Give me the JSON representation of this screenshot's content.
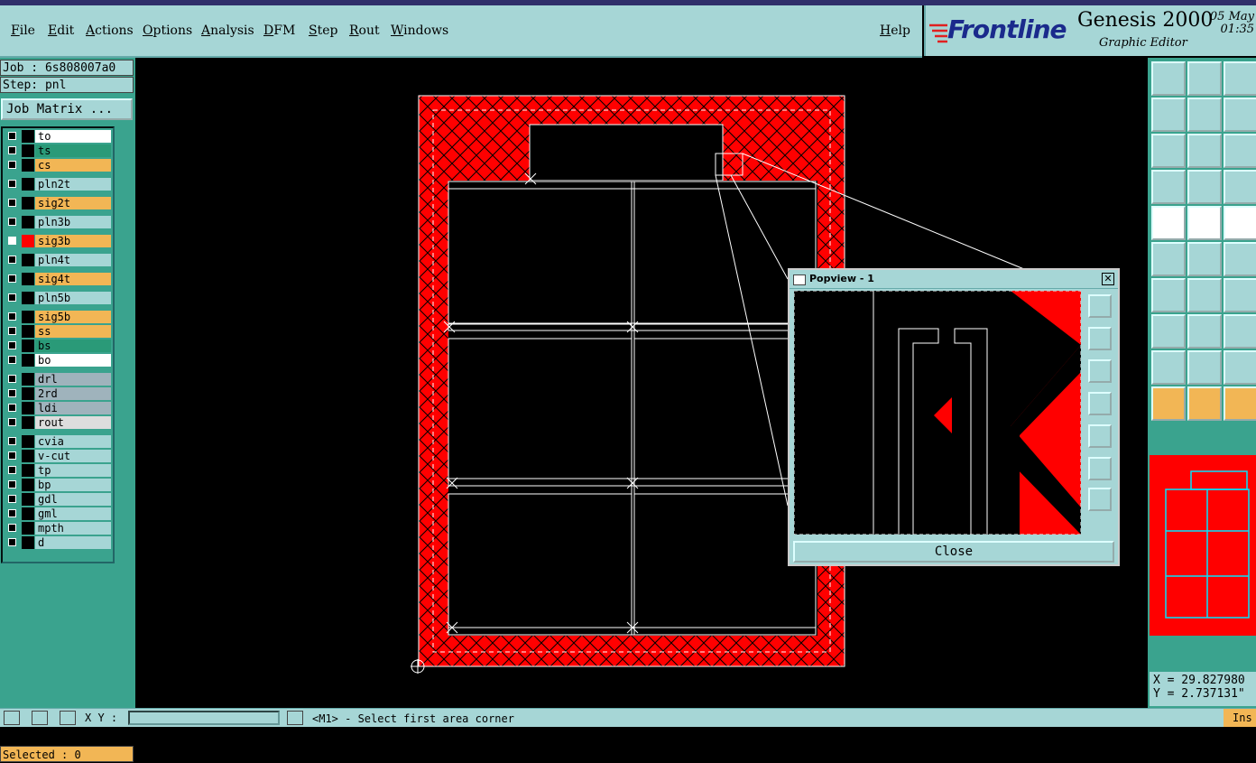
{
  "menubar": {
    "items": [
      "File",
      "Edit",
      "Actions",
      "Options",
      "Analysis",
      "DFM",
      "Step",
      "Rout",
      "Windows"
    ],
    "help": "Help"
  },
  "brand": {
    "logo": "Frontline",
    "app": "Genesis 2000",
    "subtitle": "Graphic Editor",
    "date": "05 May",
    "time": "01:35"
  },
  "job": {
    "job": "Job : 6s808007a0",
    "step": "Step: pnl",
    "matrix_button": "Job Matrix ..."
  },
  "layers": [
    {
      "name": "to",
      "color": "#ffffff"
    },
    {
      "name": "ts",
      "color": "#2a9a78"
    },
    {
      "name": "cs",
      "color": "#f2b655"
    },
    {
      "name": "pln2t",
      "color": "#a6d6d6"
    },
    {
      "name": "sig2t",
      "color": "#f2b655"
    },
    {
      "name": "pln3b",
      "color": "#a6d6d6"
    },
    {
      "name": "sig3b",
      "color": "#f2b655"
    },
    {
      "name": "pln4t",
      "color": "#a6d6d6"
    },
    {
      "name": "sig4t",
      "color": "#f2b655"
    },
    {
      "name": "pln5b",
      "color": "#a6d6d6"
    },
    {
      "name": "sig5b",
      "color": "#f2b655"
    },
    {
      "name": "ss",
      "color": "#f2b655"
    },
    {
      "name": "bs",
      "color": "#2a9a78"
    },
    {
      "name": "bo",
      "color": "#ffffff"
    },
    {
      "name": "drl",
      "color": "#9fb3bc"
    },
    {
      "name": "2rd",
      "color": "#9fb3bc"
    },
    {
      "name": "ldi",
      "color": "#9fb3bc"
    },
    {
      "name": "rout",
      "color": "#dddddd"
    },
    {
      "name": "cvia",
      "color": "#a6d6d6"
    },
    {
      "name": "v-cut",
      "color": "#a6d6d6"
    },
    {
      "name": "tp",
      "color": "#a6d6d6"
    },
    {
      "name": "bp",
      "color": "#a6d6d6"
    },
    {
      "name": "gdl",
      "color": "#a6d6d6"
    },
    {
      "name": "gml",
      "color": "#a6d6d6"
    },
    {
      "name": "mpth",
      "color": "#a6d6d6"
    },
    {
      "name": "d",
      "color": "#a6d6d6"
    }
  ],
  "active_layer": "sig3b",
  "selected": "Selected : 0",
  "popview": {
    "title": "Popview - 1",
    "close": "Close"
  },
  "coords": {
    "x": "X = 29.827980",
    "y": "Y = 2.737131\""
  },
  "status": {
    "xy_label": "X Y :",
    "message": "<M1> - Select first area corner",
    "mode": "Ins"
  },
  "colors": {
    "ui_bg": "#a6d6d6",
    "panel_teal": "#3aa38e",
    "copper": "#ff0000",
    "highlight": "#f2b655"
  }
}
